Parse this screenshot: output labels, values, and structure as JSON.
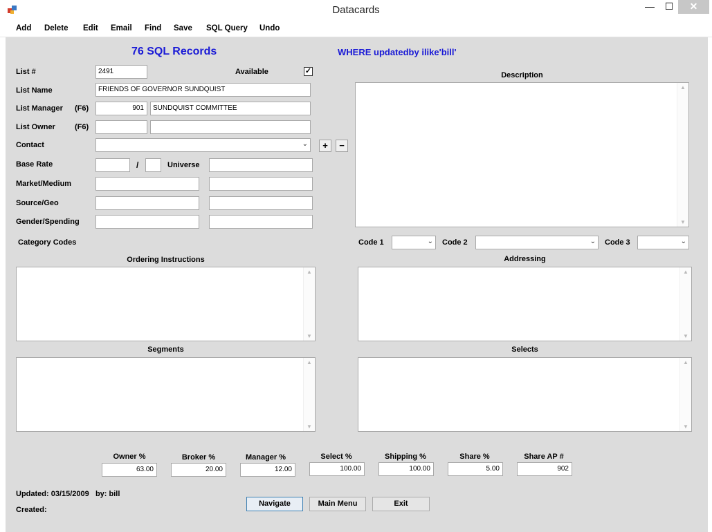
{
  "window": {
    "title": "Datacards",
    "min": "—",
    "max": "☐",
    "close": "✕"
  },
  "menu": [
    "Add",
    "Delete",
    "Edit",
    "Email",
    "Find",
    "Save",
    "SQL Query",
    "Undo"
  ],
  "header": {
    "records": "76 SQL Records",
    "query": "WHERE updatedby ilike'bill'"
  },
  "form": {
    "list_num_label": "List #",
    "list_num": "2491",
    "available_label": "Available",
    "available_mark": "✓",
    "list_name_label": "List Name",
    "list_name": "FRIENDS OF GOVERNOR SUNDQUIST",
    "list_manager_label": "List Manager",
    "f6_label": "(F6)",
    "list_manager_id": "901",
    "list_manager_name": "SUNDQUIST COMMITTEE",
    "list_owner_label": "List Owner",
    "list_owner_id": "",
    "list_owner_name": "",
    "contact_label": "Contact",
    "contact": "",
    "add_symbol": "+",
    "remove_symbol": "−",
    "base_rate_label": "Base Rate",
    "base_rate": "",
    "slash": "/",
    "base_rate_unit": "",
    "universe_label": "Universe",
    "universe": "",
    "market_label": "Market/Medium",
    "source_label": "Source/Geo",
    "gender_label": "Gender/Spending",
    "category_label": "Category Codes"
  },
  "codes": {
    "code1_label": "Code 1",
    "code2_label": "Code 2",
    "code3_label": "Code 3"
  },
  "sections": {
    "description": "Description",
    "ordering": "Ordering Instructions",
    "addressing": "Addressing",
    "segments": "Segments",
    "selects": "Selects"
  },
  "percentages": [
    {
      "label": "Owner %",
      "value": "63.00"
    },
    {
      "label": "Broker %",
      "value": "20.00"
    },
    {
      "label": "Manager %",
      "value": "12.00"
    },
    {
      "label": "Select %",
      "value": "100.00"
    },
    {
      "label": "Shipping %",
      "value": "100.00"
    },
    {
      "label": "Share %",
      "value": "5.00"
    },
    {
      "label": "Share AP #",
      "value": "902"
    }
  ],
  "footer": {
    "updated": "Updated: 03/15/2009   by: bill",
    "created": "Created:",
    "navigate": "Navigate",
    "main_menu": "Main Menu",
    "exit": "Exit"
  },
  "icons": {
    "dropdown": "⌄",
    "scroll_up": "▲",
    "scroll_down": "▼"
  },
  "colors": {
    "accent_blue": "#1a1ad6",
    "client_bg": "#dcdcdc",
    "focus_border": "#3c7fb1"
  }
}
